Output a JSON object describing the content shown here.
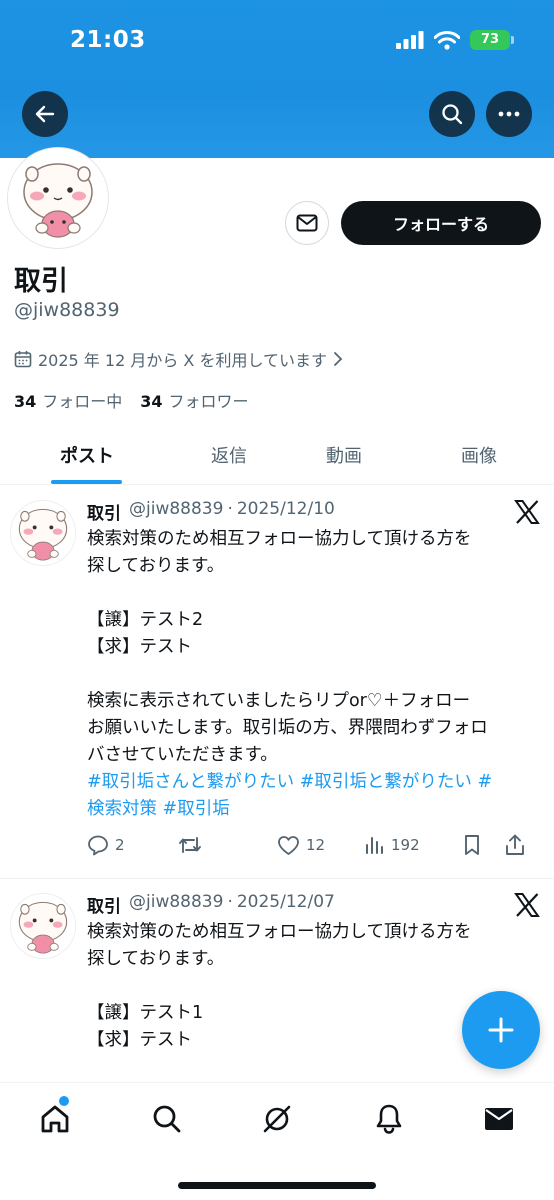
{
  "status_bar": {
    "time": "21:03",
    "battery": "73"
  },
  "profile": {
    "display_name": "取引",
    "handle": "@jiw88839",
    "joined": "2025 年 12 月から X を利用しています",
    "following_count": "34",
    "following_label": "フォロー中",
    "followers_count": "34",
    "followers_label": "フォロワー",
    "follow_button": "フォローする"
  },
  "tabs": [
    {
      "label": "ポスト",
      "active": true
    },
    {
      "label": "返信",
      "active": false
    },
    {
      "label": "動画",
      "active": false
    },
    {
      "label": "画像",
      "active": false
    }
  ],
  "posts": [
    {
      "name": "取引",
      "handle": "@jiw88839",
      "date": "2025/12/10",
      "lines": [
        "検索対策のため相互フォロー協力して頂ける方を",
        "探しております。",
        "",
        "【譲】テスト2",
        "【求】テスト",
        "",
        "検索に表示されていましたらリプor♡＋フォロー",
        "お願いいたします。取引垢の方、界隈問わずフォロ",
        "バさせていただきます。"
      ],
      "hashtags": [
        "#取引垢さんと繋がりたい  #取引垢と繋がりたい  #",
        "検索対策 #取引垢"
      ],
      "replies": "2",
      "likes": "12",
      "views": "192"
    },
    {
      "name": "取引",
      "handle": "@jiw88839",
      "date": "2025/12/07",
      "lines": [
        "検索対策のため相互フォロー協力して頂ける方を",
        "探しております。",
        "",
        "【譲】テスト1",
        "【求】テスト"
      ]
    }
  ],
  "icons": {
    "back": "arrow-left-icon",
    "search": "search-icon",
    "more": "more-icon",
    "message": "mail-icon",
    "calendar": "calendar-icon",
    "compose": "plus-icon",
    "nav": [
      "home-icon",
      "search-icon",
      "grok-icon",
      "bell-icon",
      "mail-icon"
    ]
  },
  "colors": {
    "banner": "#1d93e4",
    "accent": "#1d9bf0",
    "text": "#0f1419",
    "muted": "#536471",
    "battery": "#34c759"
  }
}
